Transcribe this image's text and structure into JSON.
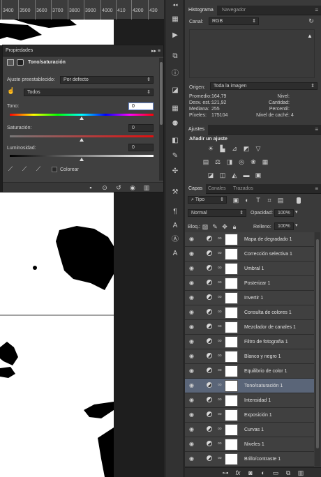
{
  "ruler": {
    "ticks": [
      "3400",
      "3500",
      "3600",
      "3700",
      "3800",
      "3900",
      "4000",
      "410",
      "4200",
      "430"
    ]
  },
  "properties": {
    "title": "Propiedades",
    "subtitle": "Tono/saturación",
    "preset_label": "Ajuste preestablecido:",
    "preset_value": "Por defecto",
    "channel_value": "Todos",
    "hue_label": "Tono:",
    "hue_value": "0",
    "sat_label": "Saturación:",
    "sat_value": "0",
    "light_label": "Luminosidad:",
    "light_value": "0",
    "colorize_label": "Colorear"
  },
  "histogram": {
    "tabs": [
      "Histograma",
      "Navegador"
    ],
    "channel_label": "Canal:",
    "channel_value": "RGB",
    "origin_label": "Origen:",
    "origin_value": "Toda la imagen",
    "stats_left": [
      {
        "label": "Promedio:",
        "value": "164,79"
      },
      {
        "label": "Desv. est.:",
        "value": "121,92"
      },
      {
        "label": "Mediana:",
        "value": "255"
      },
      {
        "label": "Píxeles:",
        "value": "175104"
      }
    ],
    "stats_right": [
      {
        "label": "Nivel:",
        "value": ""
      },
      {
        "label": "Cantidad:",
        "value": ""
      },
      {
        "label": "Percentil:",
        "value": ""
      },
      {
        "label": "Nivel de caché:",
        "value": "4"
      }
    ]
  },
  "adjustments": {
    "tab": "Ajustes",
    "title": "Añadir un ajuste"
  },
  "layers": {
    "tabs": [
      "Capas",
      "Canales",
      "Trazados"
    ],
    "filter_value": "Tipo",
    "blend_value": "Normal",
    "opacity_label": "Opacidad:",
    "opacity_value": "100%",
    "lock_label": "Bloq.:",
    "fill_label": "Relleno:",
    "fill_value": "100%",
    "items": [
      "Mapa de degradado 1",
      "Corrección selectiva 1",
      "Umbral 1",
      "Posterizar 1",
      "Invertir 1",
      "Consulta de colores 1",
      "Mezclador de canales 1",
      "Filtro de fotografía 1",
      "Blanco y negro 1",
      "Equilibrio de color 1",
      "Tono/saturación 1",
      "Intensidad 1",
      "Exposición 1",
      "Curvas 1",
      "Niveles 1",
      "Brillo/contraste 1"
    ],
    "selected_index": 10
  }
}
